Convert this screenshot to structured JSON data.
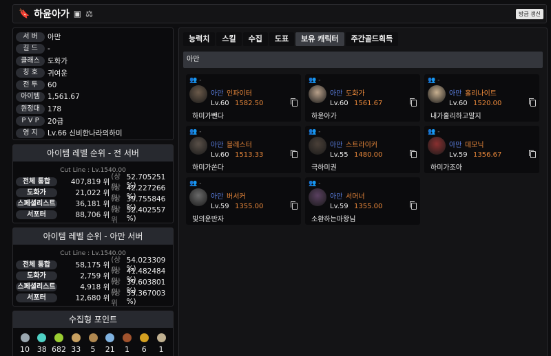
{
  "header": {
    "title": "하윤아가",
    "refresh_label": "방금 갱신",
    "icons": [
      "bookmark-icon",
      "id-card-icon",
      "scales-icon"
    ]
  },
  "profile": {
    "rows": [
      {
        "label": "서 버",
        "value": "아만"
      },
      {
        "label": "길 드",
        "value": "-"
      },
      {
        "label": "클래스",
        "value": "도화가"
      },
      {
        "label": "칭 호",
        "value": "귀여운"
      },
      {
        "label": "전 투",
        "value": "60"
      },
      {
        "label": "아이템",
        "value": "1,561.67"
      },
      {
        "label": "원정대",
        "value": "178"
      },
      {
        "label": "P V P",
        "value": "20급"
      },
      {
        "label": "영 지",
        "value": "Lv.66 신비한나라의하미"
      }
    ]
  },
  "rank_all": {
    "title": "아이템 레벨 순위 - 전 서버",
    "cutline": "Cut Line : Lv.1540.00",
    "rows": [
      {
        "label": "전체 통합",
        "rank": "407,819 위",
        "sub": "(상위",
        "pct": "52.705251 %)"
      },
      {
        "label": "도화가",
        "rank": "21,022 위",
        "sub": "(상위",
        "pct": "42.227266 %)"
      },
      {
        "label": "스페셜리스트",
        "rank": "36,181 위",
        "sub": "(상위",
        "pct": "39.755846 %)"
      },
      {
        "label": "서포터",
        "rank": "88,706 위",
        "sub": "(상위",
        "pct": "52.402557 %)"
      }
    ]
  },
  "rank_server": {
    "title": "아이템 레벨 순위 - 아만 서버",
    "cutline": "Cut Line : Lv.1540.00",
    "rows": [
      {
        "label": "전체 통합",
        "rank": "58,175 위",
        "sub": "(상위",
        "pct": "54.023309 %)"
      },
      {
        "label": "도화가",
        "rank": "2,759 위",
        "sub": "(상위",
        "pct": "41.482484 %)"
      },
      {
        "label": "스페셜리스트",
        "rank": "4,918 위",
        "sub": "(상위",
        "pct": "39.603801 %)"
      },
      {
        "label": "서포터",
        "rank": "12,680 위",
        "sub": "(상위",
        "pct": "53.367003 %)"
      }
    ]
  },
  "collectibles": {
    "title": "수집형 포인트",
    "items": [
      {
        "icon": "mokoko-seed-icon",
        "value": "10",
        "color": "#9aa7b0"
      },
      {
        "icon": "island-heart-icon",
        "value": "38",
        "color": "#4fd1c5"
      },
      {
        "icon": "giant-heart-icon",
        "value": "682",
        "color": "#9acd32"
      },
      {
        "icon": "art-icon",
        "value": "33",
        "color": "#c8a060"
      },
      {
        "icon": "voyage-icon",
        "value": "5",
        "color": "#b08850"
      },
      {
        "icon": "world-tree-leaf-icon",
        "value": "21",
        "color": "#7fb2e0"
      },
      {
        "icon": "ignea-icon",
        "value": "1",
        "color": "#a0522d"
      },
      {
        "icon": "orpheus-star-icon",
        "value": "6",
        "color": "#d4a020"
      },
      {
        "icon": "memory-orgel-icon",
        "value": "1",
        "color": "#c0b090"
      }
    ]
  },
  "tabs": [
    "능력치",
    "스킬",
    "수집",
    "도표",
    "보유 캐릭터",
    "주간골드획득"
  ],
  "active_tab": "보유 캐릭터",
  "server_bar": "아만",
  "characters": [
    {
      "guild": "-",
      "server": "아만",
      "class": "인파이터",
      "level": "Lv.60",
      "ilvl": "1582.50",
      "name": "하미가뺀다",
      "avatar_color": "#6b5a4a"
    },
    {
      "guild": "-",
      "server": "아만",
      "class": "도화가",
      "level": "Lv.60",
      "ilvl": "1561.67",
      "name": "하윤아가",
      "avatar_color": "#b8a08a"
    },
    {
      "guild": "-",
      "server": "아만",
      "class": "홀리나이트",
      "level": "Lv.60",
      "ilvl": "1520.00",
      "name": "내가홀리하고말지",
      "avatar_color": "#c8b090"
    },
    {
      "guild": "-",
      "server": "아만",
      "class": "블레스터",
      "level": "Lv.60",
      "ilvl": "1513.33",
      "name": "하미가쏜다",
      "avatar_color": "#5a5048"
    },
    {
      "guild": "-",
      "server": "아만",
      "class": "스트라이커",
      "level": "Lv.55",
      "ilvl": "1480.00",
      "name": "극하미권",
      "avatar_color": "#4a4038"
    },
    {
      "guild": "-",
      "server": "아만",
      "class": "데모닉",
      "level": "Lv.59",
      "ilvl": "1356.67",
      "name": "하미가조아",
      "avatar_color": "#8a3030"
    },
    {
      "guild": "-",
      "server": "아만",
      "class": "버서커",
      "level": "Lv.59",
      "ilvl": "1355.00",
      "name": "빛의운반자",
      "avatar_color": "#6a6a6a"
    },
    {
      "guild": "-",
      "server": "아만",
      "class": "서머너",
      "level": "Lv.59",
      "ilvl": "1355.00",
      "name": "소환하는마왕님",
      "avatar_color": "#5a4060"
    }
  ]
}
